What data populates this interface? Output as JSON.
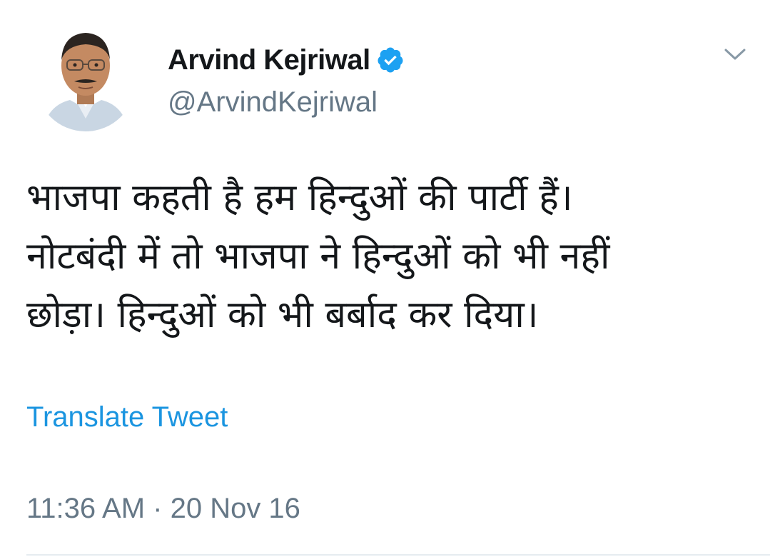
{
  "author": {
    "display_name": "Arvind Kejriwal",
    "handle": "@ArvindKejriwal",
    "verified": true,
    "avatar_icon": "profile-photo"
  },
  "tweet": {
    "text": "भाजपा कहती है हम हिन्दुओं की पार्टी हैं।\nनोटबंदी में तो भाजपा ने हिन्दुओं को भी नहीं\nछोड़ा। हिन्दुओं को भी बर्बाद कर दिया।",
    "translate_label": "Translate Tweet",
    "timestamp": "11:36 AM · 20 Nov 16"
  },
  "icons": {
    "verified": "verified-badge-icon",
    "menu": "chevron-down-icon"
  },
  "colors": {
    "text_primary": "#14171a",
    "text_secondary": "#657786",
    "link": "#1b95e0",
    "verified": "#1da1f2"
  }
}
